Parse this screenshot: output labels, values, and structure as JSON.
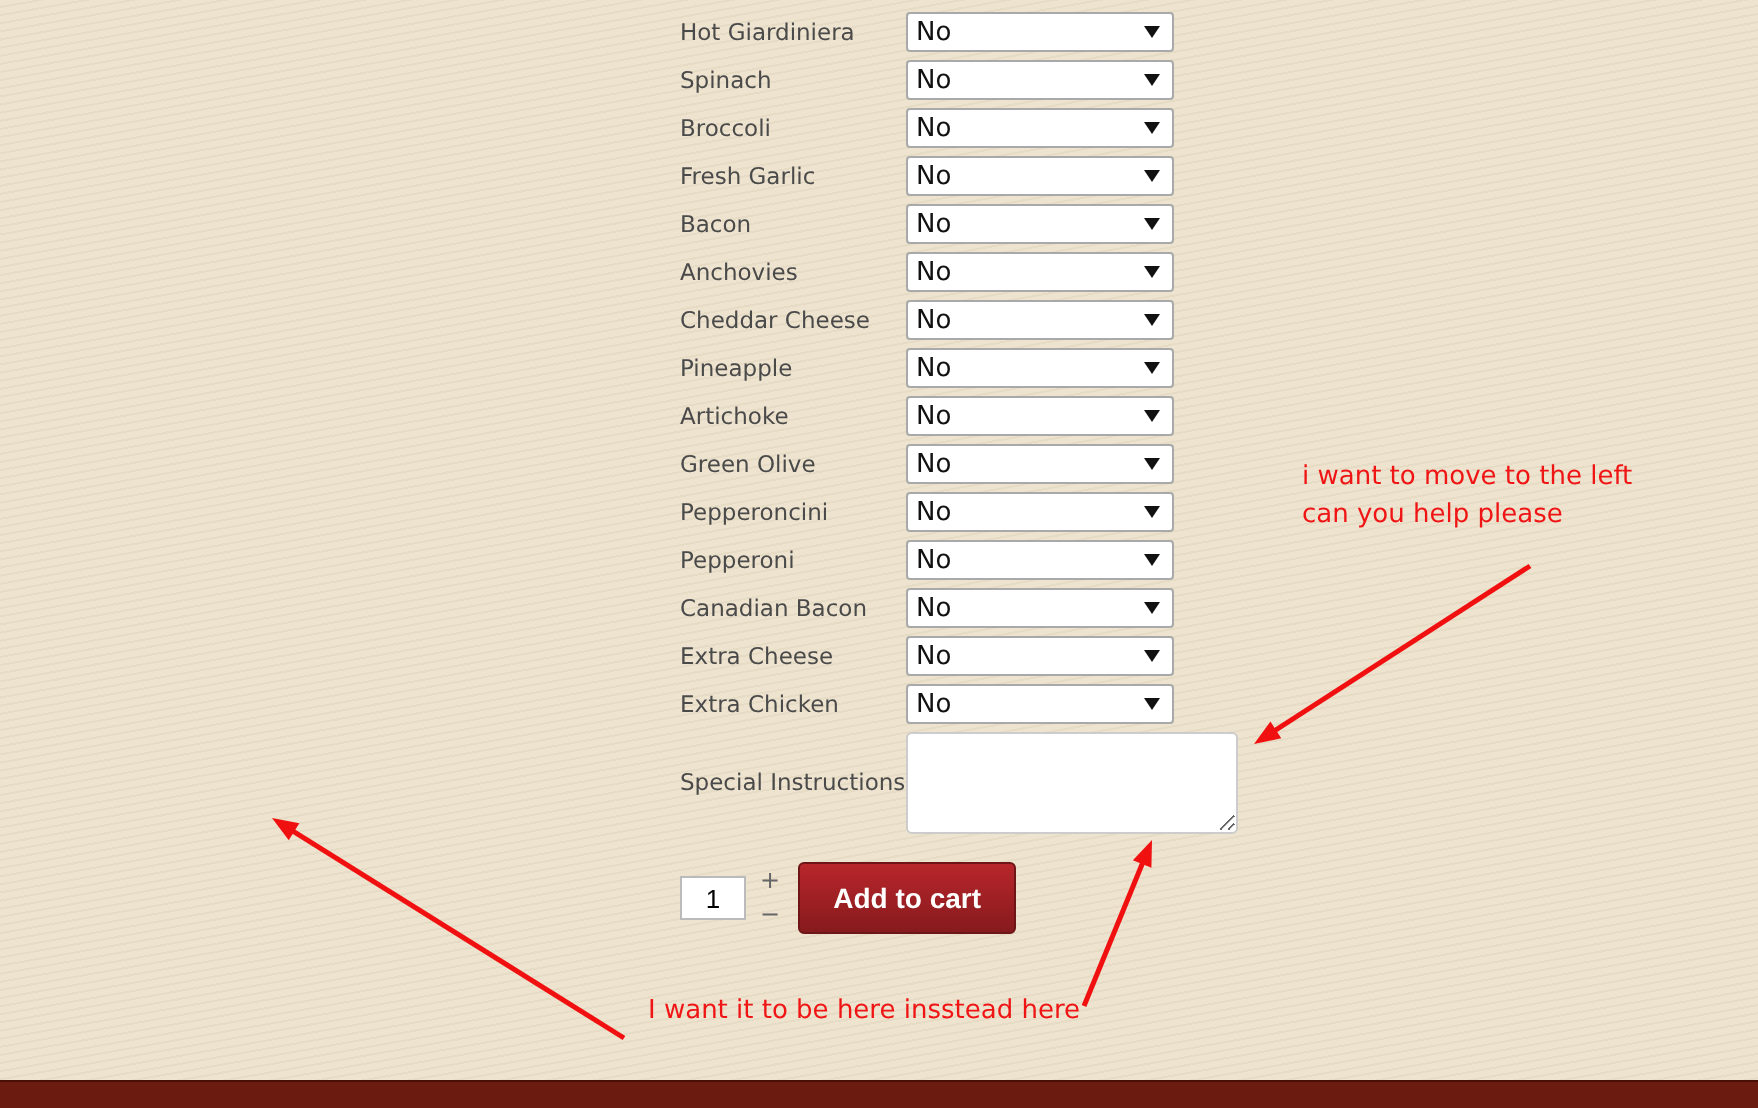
{
  "toppings": [
    {
      "label": "Hot Giardiniera",
      "value": "No"
    },
    {
      "label": "Spinach",
      "value": "No"
    },
    {
      "label": "Broccoli",
      "value": "No"
    },
    {
      "label": "Fresh Garlic",
      "value": "No"
    },
    {
      "label": "Bacon",
      "value": "No"
    },
    {
      "label": "Anchovies",
      "value": "No"
    },
    {
      "label": "Cheddar Cheese",
      "value": "No"
    },
    {
      "label": "Pineapple",
      "value": "No"
    },
    {
      "label": "Artichoke",
      "value": "No"
    },
    {
      "label": "Green Olive",
      "value": "No"
    },
    {
      "label": "Pepperoncini",
      "value": "No"
    },
    {
      "label": "Pepperoni",
      "value": "No"
    },
    {
      "label": "Canadian Bacon",
      "value": "No"
    },
    {
      "label": "Extra Cheese",
      "value": "No"
    },
    {
      "label": "Extra Chicken",
      "value": "No"
    }
  ],
  "special_instructions": {
    "label": "Special Instructions"
  },
  "quantity": {
    "value": "1",
    "increment": "+",
    "decrement": "−"
  },
  "add_to_cart": "Add to cart",
  "notes": [
    {
      "lines": [
        "i want to move to the left",
        "can you help please"
      ]
    },
    {
      "lines": [
        "I want it to be here insstead here"
      ]
    }
  ]
}
